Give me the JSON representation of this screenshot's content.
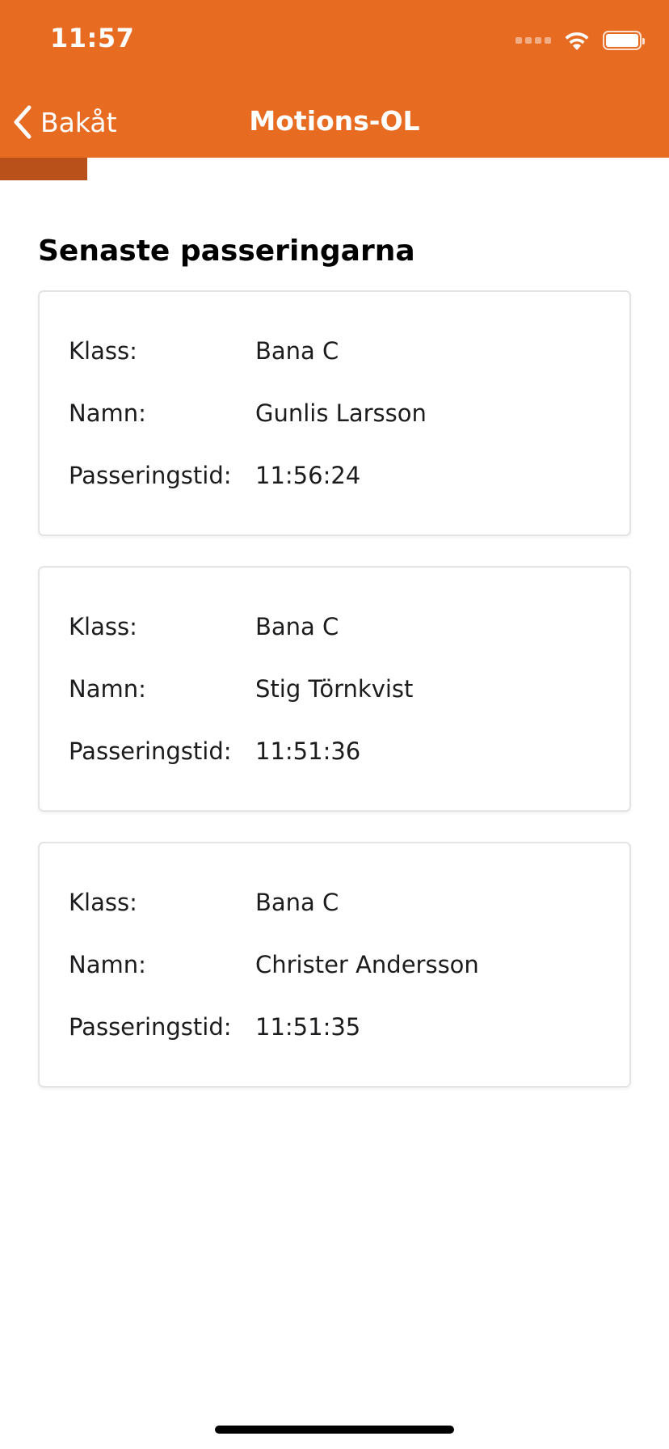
{
  "status_bar": {
    "time": "11:57"
  },
  "nav": {
    "back_label": "Bakåt",
    "title": "Motions-OL"
  },
  "progress": {
    "fraction": 0.13
  },
  "section": {
    "title": "Senaste passeringarna"
  },
  "labels": {
    "class": "Klass:",
    "name": "Namn:",
    "time": "Passeringstid:"
  },
  "passings": [
    {
      "class": "Bana C",
      "name": "Gunlis Larsson",
      "time": "11:56:24"
    },
    {
      "class": "Bana C",
      "name": "Stig Törnkvist",
      "time": "11:51:36"
    },
    {
      "class": "Bana C",
      "name": "Christer Andersson",
      "time": "11:51:35"
    }
  ],
  "colors": {
    "header_bg": "#E86B22",
    "progress_fill": "#B8521A"
  },
  "icons": {
    "back": "chevron-left-icon",
    "wifi": "wifi-icon",
    "battery": "battery-icon",
    "signal": "cellular-signal-icon"
  }
}
